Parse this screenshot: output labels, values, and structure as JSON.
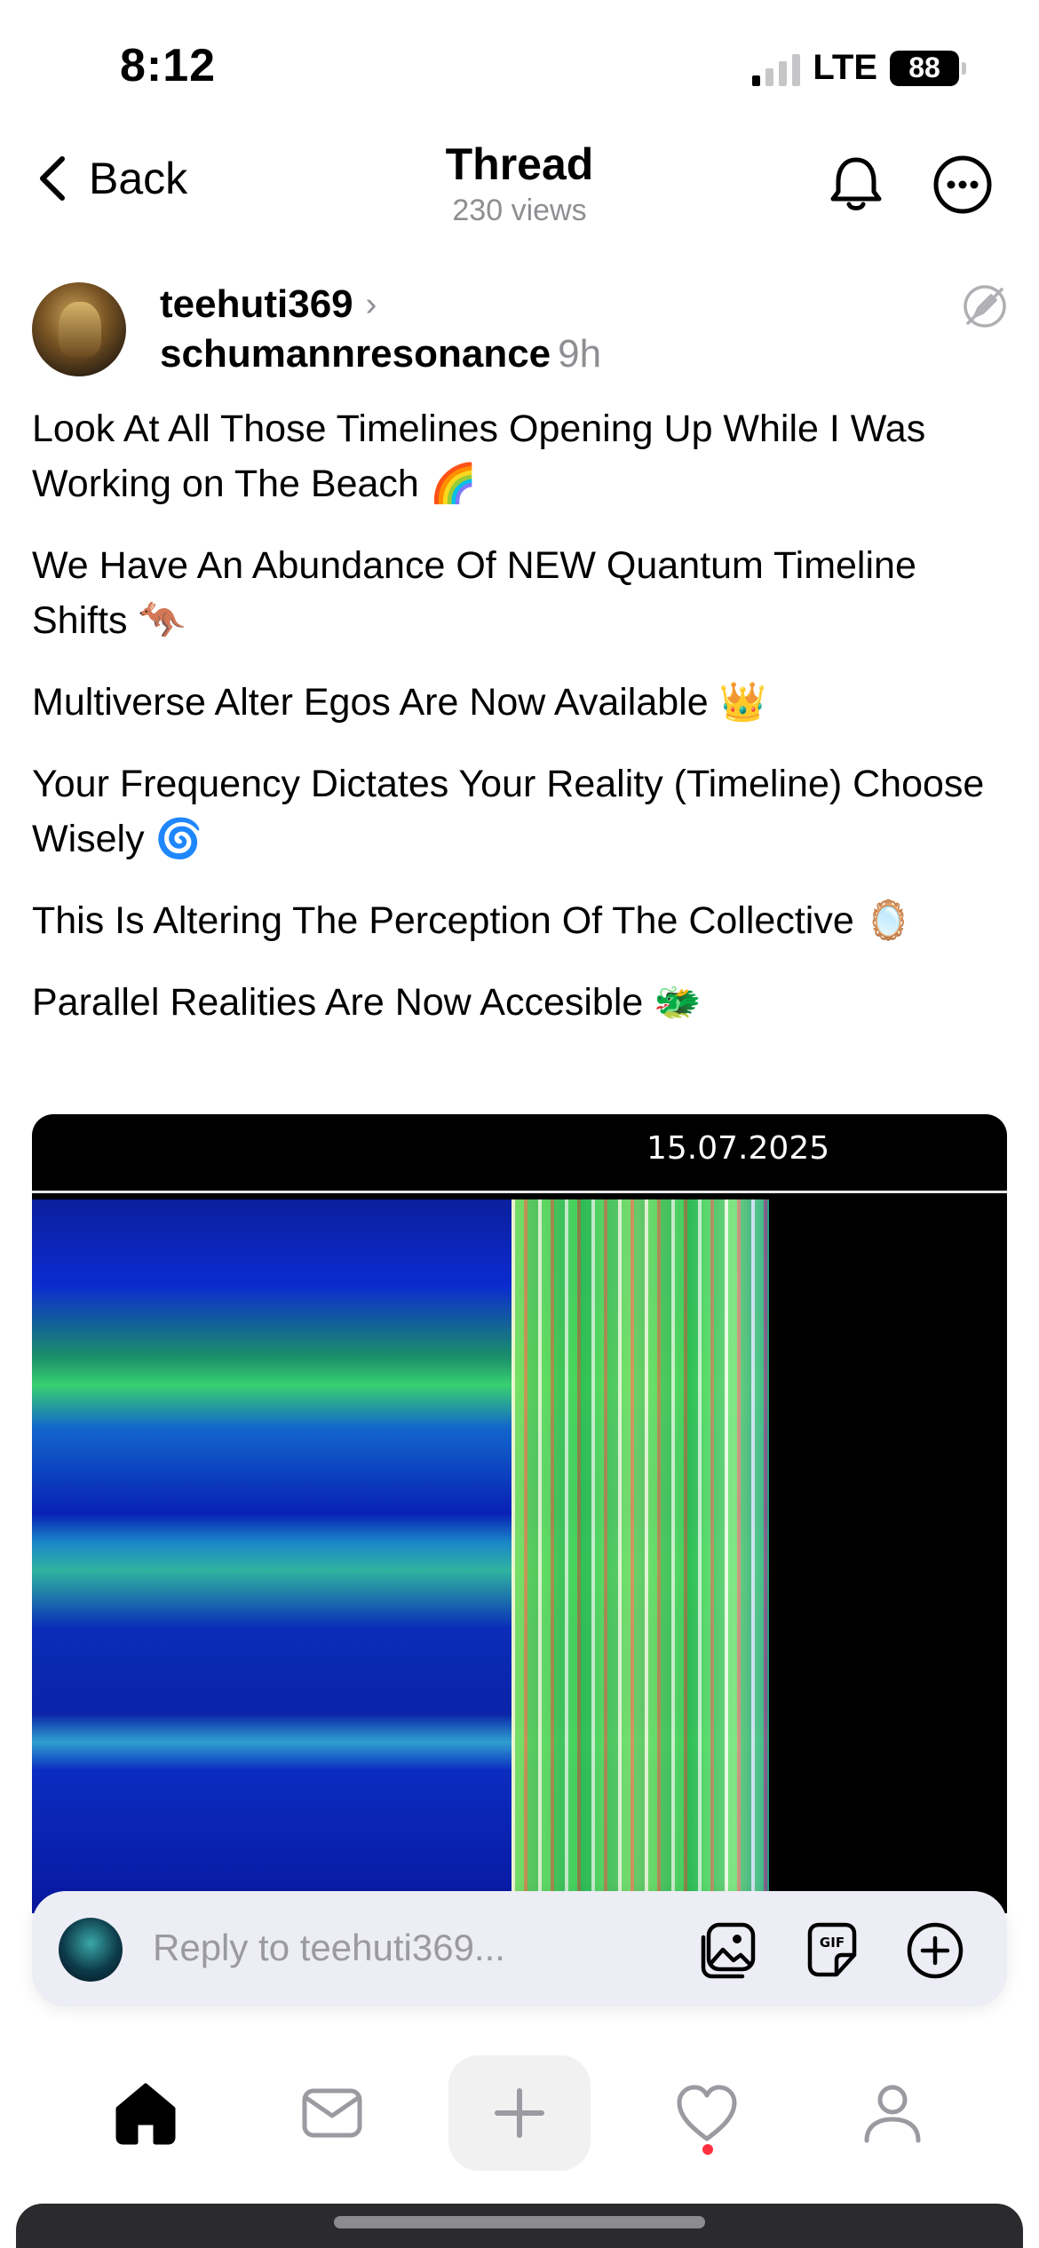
{
  "status_bar": {
    "time": "8:12",
    "network": "LTE",
    "battery": "88"
  },
  "header": {
    "back_label": "Back",
    "title": "Thread",
    "views": "230 views"
  },
  "post": {
    "username": "teehuti369",
    "topic": "schumannresonance",
    "age": "9h",
    "paragraphs": [
      "Look At All Those Timelines Opening Up While I Was Working on The Beach 🌈",
      "We Have An Abundance Of NEW Quantum Timeline Shifts 🦘",
      "Multiverse Alter Egos Are Now Available 👑",
      "Your Frequency Dictates Your Reality (Timeline) Choose Wisely 🌀",
      "This Is Altering The Perception Of The Collective 🪞",
      "Parallel Realities Are Now Accesible 🐲"
    ],
    "image_date": "15.07.2025"
  },
  "reply": {
    "placeholder": "Reply to teehuti369..."
  },
  "icons": {
    "back": "chevron-left-icon",
    "bell": "bell-icon",
    "more": "more-icon",
    "edit": "edit-off-icon",
    "image": "image-icon",
    "gif": "gif-icon",
    "add": "plus-circle-icon",
    "home": "home-icon",
    "inbox": "mail-icon",
    "create": "plus-icon",
    "activity": "heart-icon",
    "profile": "person-icon"
  },
  "colors": {
    "secondary_text": "#8e8e93",
    "notification_dot": "#ff3040",
    "reply_bar_bg": "#ecedf5"
  }
}
